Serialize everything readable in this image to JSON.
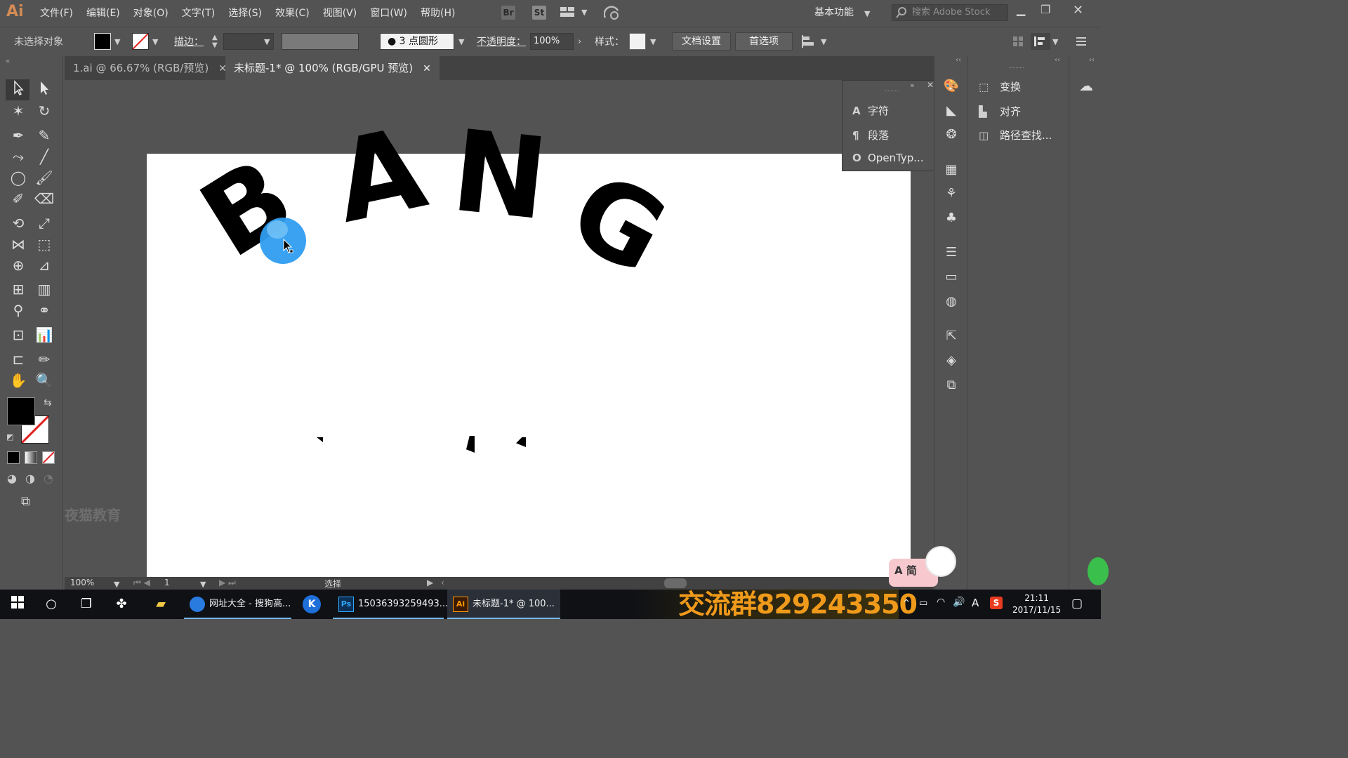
{
  "app": {
    "logo": "Ai"
  },
  "menu": [
    "文件(F)",
    "编辑(E)",
    "对象(O)",
    "文字(T)",
    "选择(S)",
    "效果(C)",
    "视图(V)",
    "窗口(W)",
    "帮助(H)"
  ],
  "menubar_icons": {
    "bridge": "Br",
    "stock": "St"
  },
  "workspace": {
    "label": "基本功能"
  },
  "search": {
    "placeholder": "搜索 Adobe Stock"
  },
  "controlbar": {
    "selection_label": "未选择对象",
    "stroke_label": "描边：",
    "brush_label": "3 点圆形",
    "opacity_label": "不透明度：",
    "opacity_value": "100%",
    "style_label": "样式：",
    "doc_settings": "文档设置",
    "preferences": "首选项"
  },
  "tabs": [
    {
      "label": "1.ai @ 66.67% (RGB/预览)",
      "active": false
    },
    {
      "label": "未标题-1* @ 100% (RGB/GPU 预览)",
      "active": true
    }
  ],
  "artwork": {
    "letters": [
      "B",
      "A",
      "N",
      "G"
    ]
  },
  "watermark": "夜猫教育",
  "char_panel": {
    "items": [
      {
        "icon": "A",
        "label": "字符"
      },
      {
        "icon": "¶",
        "label": "段落"
      },
      {
        "icon": "O",
        "label": "OpenTyp..."
      }
    ]
  },
  "right_panel": {
    "items": [
      {
        "label": "变换"
      },
      {
        "label": "对齐"
      },
      {
        "label": "路径查找..."
      }
    ]
  },
  "statusbar": {
    "zoom": "100%",
    "page": "1",
    "tool": "选择"
  },
  "taskbar": {
    "apps": [
      {
        "label": "网址大全 - 搜狗高...",
        "active": false
      },
      {
        "label": "15036393259493...",
        "active": false
      },
      {
        "label": "未标题-1* @ 100...",
        "active": true
      }
    ],
    "promo_text": "交流群829243350",
    "ime": "A",
    "time": "21:11",
    "date": "2017/11/15",
    "sticker_text": "A 简"
  },
  "colors": {
    "accent": "#2f9df0",
    "promo": "#f09a1b",
    "ai_orange": "#d48b54"
  }
}
